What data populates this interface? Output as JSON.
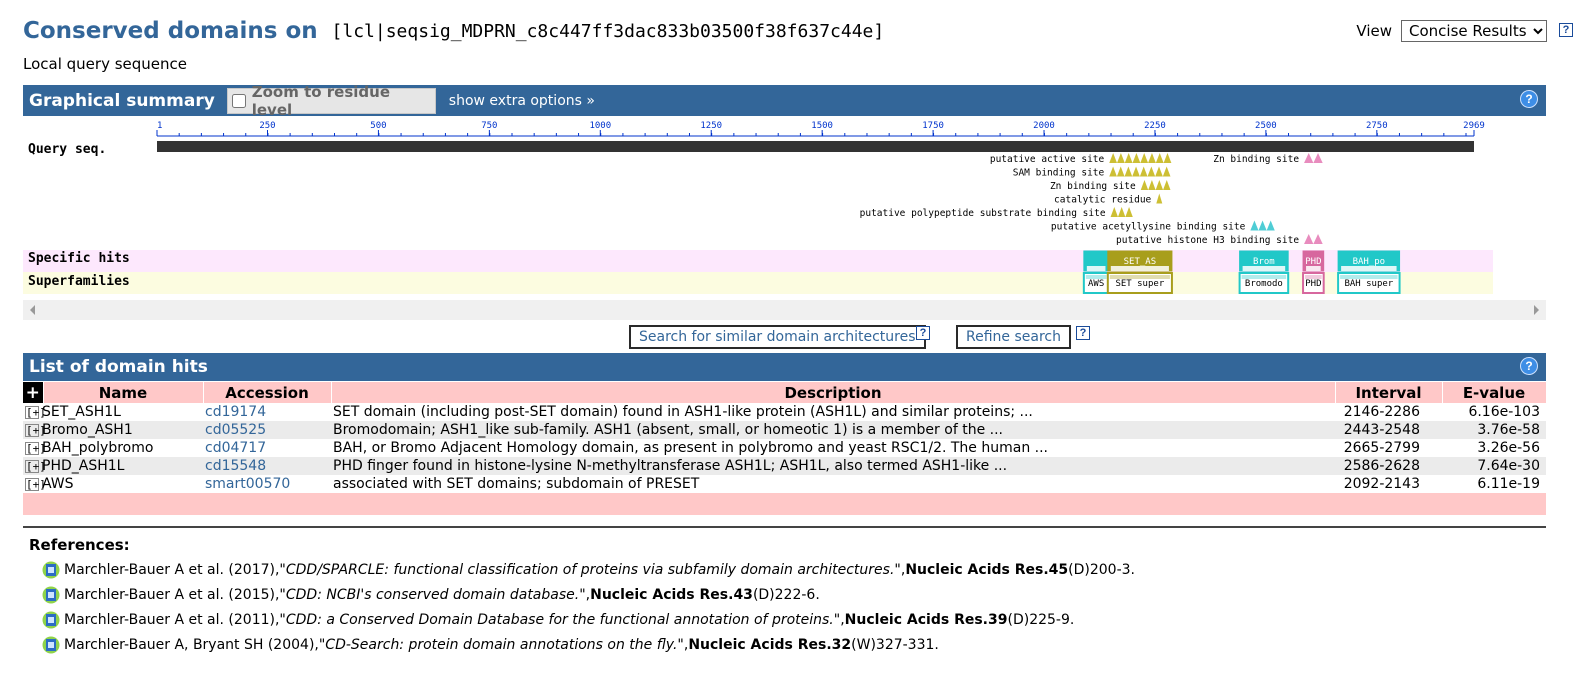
{
  "header": {
    "title": "Conserved domains on",
    "query_id": "[lcl|seqsig_MDPRN_c8c447ff3dac833b03500f38f637c44e]",
    "subtitle": "Local query sequence",
    "view_label": "View",
    "view_selected": "Concise Results",
    "help_glyph": "?"
  },
  "graphical_summary": {
    "title": "Graphical summary",
    "zoom_label": "Zoom to residue level",
    "extra_options": "show extra options »",
    "help_glyph": "?",
    "query_label": "Query seq.",
    "query_length": 2969,
    "ruler_ticks": [
      1,
      250,
      500,
      750,
      1000,
      1250,
      1500,
      1750,
      2000,
      2250,
      2500,
      2750,
      2969
    ],
    "sites": [
      {
        "label": "putative active site",
        "start": 2147,
        "end": 2287,
        "color": "#c8b81e",
        "row": 0
      },
      {
        "label": "Zn binding site",
        "start": 2586,
        "end": 2628,
        "color": "#e57fb7",
        "row": 0
      },
      {
        "label": "SAM binding site",
        "start": 2147,
        "end": 2285,
        "color": "#c8b81e",
        "row": 1
      },
      {
        "label": "Zn binding site",
        "start": 2218,
        "end": 2285,
        "color": "#c8b81e",
        "row": 2
      },
      {
        "label": "catalytic residue",
        "start": 2253,
        "end": 2260,
        "color": "#c8b81e",
        "row": 3
      },
      {
        "label": "putative polypeptide substrate binding site",
        "start": 2150,
        "end": 2200,
        "color": "#c8b81e",
        "row": 4
      },
      {
        "label": "putative acetyllysine binding site",
        "start": 2465,
        "end": 2520,
        "color": "#3cc8d0",
        "row": 5
      },
      {
        "label": "putative histone H3 binding site",
        "start": 2586,
        "end": 2628,
        "color": "#e57fb7",
        "row": 6
      }
    ],
    "specific_hits_label": "Specific hits",
    "superfamilies_label": "Superfamilies",
    "specific_hits": [
      {
        "name": "",
        "start": 2092,
        "end": 2143,
        "color": "#21c8c8"
      },
      {
        "name": "SET_AS",
        "start": 2146,
        "end": 2286,
        "color": "#a89e1c"
      },
      {
        "name": "Brom",
        "start": 2443,
        "end": 2548,
        "color": "#21c8c8"
      },
      {
        "name": "PHD",
        "start": 2586,
        "end": 2628,
        "color": "#d7679e"
      },
      {
        "name": "BAH_po",
        "start": 2665,
        "end": 2799,
        "color": "#21c8c8"
      }
    ],
    "superfamilies": [
      {
        "name": "AWS",
        "start": 2092,
        "end": 2143,
        "color": "#21c8c8"
      },
      {
        "name": "SET super",
        "start": 2146,
        "end": 2286,
        "color": "#a89e1c"
      },
      {
        "name": "Bromodo",
        "start": 2443,
        "end": 2548,
        "color": "#21c8c8"
      },
      {
        "name": "PHD",
        "start": 2586,
        "end": 2628,
        "color": "#d7679e"
      },
      {
        "name": "BAH super",
        "start": 2665,
        "end": 2799,
        "color": "#21c8c8"
      }
    ]
  },
  "actions": {
    "similar_arch": "Search for similar domain architectures",
    "refine": "Refine search",
    "help_glyph": "?"
  },
  "domain_hits": {
    "title": "List of domain hits",
    "help_glyph": "?",
    "expand_all_glyph": "+",
    "expand_glyph": "[+]",
    "columns": [
      "Name",
      "Accession",
      "Description",
      "Interval",
      "E-value"
    ],
    "rows": [
      {
        "name": "SET_ASH1L",
        "accession": "cd19174",
        "description": "SET domain (including post-SET domain) found in ASH1-like protein (ASH1L) and similar proteins; ...",
        "interval": "2146-2286",
        "evalue": "6.16e-103"
      },
      {
        "name": "Bromo_ASH1",
        "accession": "cd05525",
        "description": "Bromodomain; ASH1_like sub-family. ASH1 (absent, small, or homeotic 1) is a member of the ...",
        "interval": "2443-2548",
        "evalue": "3.76e-58"
      },
      {
        "name": "BAH_polybromo",
        "accession": "cd04717",
        "description": "BAH, or Bromo Adjacent Homology domain, as present in polybromo and yeast RSC1/2. The human ...",
        "interval": "2665-2799",
        "evalue": "3.26e-56"
      },
      {
        "name": "PHD_ASH1L",
        "accession": "cd15548",
        "description": "PHD finger found in histone-lysine N-methyltransferase ASH1L; ASH1L, also termed ASH1-like ...",
        "interval": "2586-2628",
        "evalue": "7.64e-30"
      },
      {
        "name": "AWS",
        "accession": "smart00570",
        "description": "associated with SET domains; subdomain of PRESET",
        "interval": "2092-2143",
        "evalue": "6.11e-19"
      }
    ]
  },
  "references": {
    "title": "References:",
    "items": [
      {
        "authors": "Marchler-Bauer A et al. (2017), ",
        "title": "\"CDD/SPARCLE: functional classification of proteins via subfamily domain architectures.\"",
        "sep": ", ",
        "journal": "Nucleic Acids Res.45",
        "pages": "(D)200-3."
      },
      {
        "authors": "Marchler-Bauer A et al. (2015), ",
        "title": "\"CDD: NCBI's conserved domain database.\"",
        "sep": ", ",
        "journal": "Nucleic Acids Res.43",
        "pages": "(D)222-6."
      },
      {
        "authors": "Marchler-Bauer A et al. (2011), ",
        "title": "\"CDD: a Conserved Domain Database for the functional annotation of proteins.\"",
        "sep": ", ",
        "journal": "Nucleic Acids Res.39",
        "pages": "(D)225-9."
      },
      {
        "authors": "Marchler-Bauer A, Bryant SH (2004), ",
        "title": "\"CD-Search: protein domain annotations on the fly.\"",
        "sep": ", ",
        "journal": "Nucleic Acids Res.32",
        "pages": "(W)327-331."
      }
    ]
  }
}
